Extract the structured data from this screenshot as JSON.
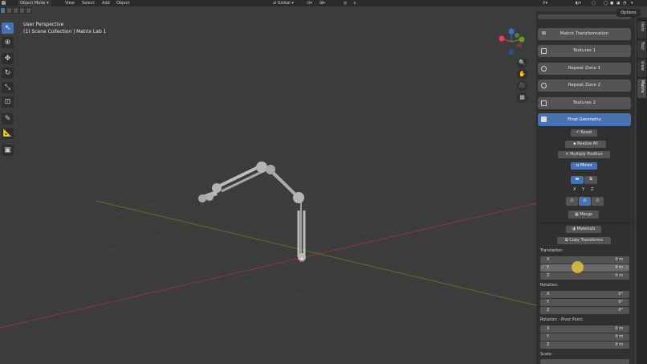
{
  "header": {
    "mode_label": "Object Mode",
    "menus": [
      "View",
      "Select",
      "Add",
      "Object"
    ],
    "transform_orientation": "Global"
  },
  "viewport": {
    "title": "User Perspective",
    "subtitle": "(1) Scene Collection | Matrix Lab 1"
  },
  "gizmo": {
    "x_color": "#e0434d",
    "y_color": "#6a9a2c",
    "z_color": "#3b6fcc"
  },
  "panel": {
    "options_label": "Options",
    "tabs": [
      "Item",
      "Tool",
      "View",
      "Matrix"
    ],
    "buttons": {
      "matrix_transformation": "Matrix Transformation",
      "textures_1": "Textures 1",
      "repeat_zone_1": "Repeat Zone 1",
      "repeat_zone_2": "Repeat Zone 2",
      "textures_2": "Textures 2",
      "final_geometry": "Final Geometry"
    },
    "actions": {
      "reset": "Reset",
      "realize_all": "Realize All",
      "multiply_position": "Multiply Position",
      "mirror": "Mirror",
      "merge": "Merge",
      "materials": "Materials",
      "copy_transforms": "Copy Transforms"
    },
    "axes": [
      "X",
      "Y",
      "Z"
    ],
    "translation": {
      "label": "Translation:",
      "rows": [
        {
          "axis": "X",
          "value": "0 m"
        },
        {
          "axis": "Y",
          "value": "0 m"
        },
        {
          "axis": "Z",
          "value": "0 m"
        }
      ]
    },
    "rotation": {
      "label": "Rotation:",
      "rows": [
        {
          "axis": "X",
          "value": "0°"
        },
        {
          "axis": "Y",
          "value": "0°"
        },
        {
          "axis": "Z",
          "value": "0°"
        }
      ]
    },
    "pivot": {
      "label": "Rotation - Pivot Point:",
      "rows": [
        {
          "axis": "X",
          "value": "0 m"
        },
        {
          "axis": "Y",
          "value": "0 m"
        },
        {
          "axis": "Z",
          "value": "0 m"
        }
      ]
    },
    "scale_label": "Scale:"
  },
  "colors": {
    "accent": "#4772b3",
    "panel_bg": "#303030",
    "viewport_bg": "#3c3c3c",
    "cursor": "#e0c43a"
  }
}
